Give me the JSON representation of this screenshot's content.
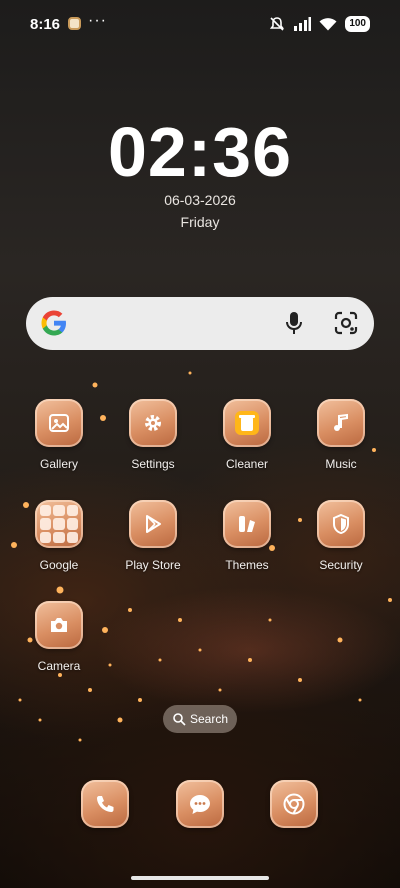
{
  "status_bar": {
    "time": "8:16",
    "dots": "···",
    "battery": "100",
    "icons": [
      "notification-app-icon",
      "mute-icon",
      "signal-icon",
      "wifi-icon",
      "battery-icon"
    ]
  },
  "lock_clock": {
    "time": "02:36",
    "date": "06-03-2026",
    "weekday": "Friday"
  },
  "search_widget": {
    "icons": [
      "google-logo-icon",
      "microphone-icon",
      "google-lens-icon"
    ]
  },
  "apps": [
    {
      "label": "Gallery",
      "icon": "gallery-icon"
    },
    {
      "label": "Settings",
      "icon": "gear-icon"
    },
    {
      "label": "Cleaner",
      "icon": "trash-icon"
    },
    {
      "label": "Music",
      "icon": "music-note-icon"
    },
    {
      "label": "Google",
      "icon": "folder-icon"
    },
    {
      "label": "Play Store",
      "icon": "play-store-icon"
    },
    {
      "label": "Themes",
      "icon": "themes-icon"
    },
    {
      "label": "Security",
      "icon": "shield-icon"
    },
    {
      "label": "Camera",
      "icon": "camera-icon"
    }
  ],
  "page_search": {
    "label": "Search"
  },
  "dock": [
    {
      "icon": "phone-icon"
    },
    {
      "icon": "messages-icon"
    },
    {
      "icon": "chrome-icon"
    }
  ],
  "colors": {
    "icon_gradient_top": "#f2c19e",
    "icon_gradient_bottom": "#b9673e",
    "cleaner_accent": "#ffb619",
    "search_bar": "#ececec"
  }
}
